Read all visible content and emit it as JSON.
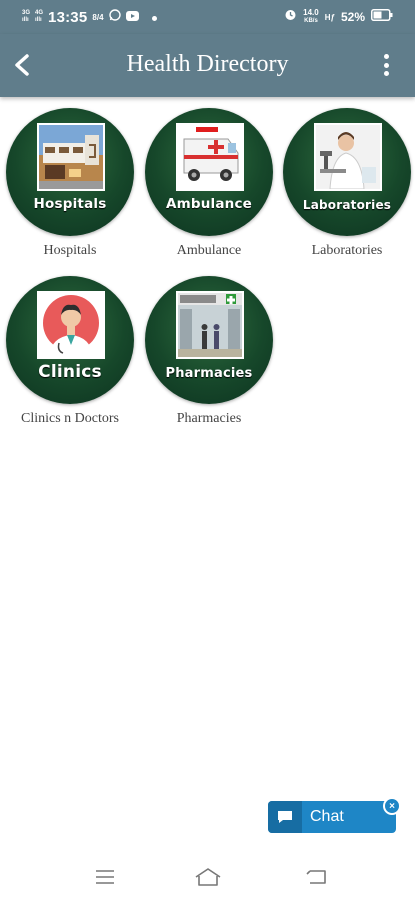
{
  "status_bar": {
    "net1_top": "3G",
    "net1_bottom": "ıllı",
    "net2_top": "4G",
    "net2_bottom": "ıllı",
    "time": "13:35",
    "data_rate_small": "8/4",
    "speed_value": "14.0",
    "speed_unit": "KB/s",
    "volte": "Hƒ",
    "battery_percent": "52%"
  },
  "app_bar": {
    "title": "Health Directory"
  },
  "categories": [
    {
      "circle_label": "Hospitals",
      "caption": "Hospitals"
    },
    {
      "circle_label": "Ambulance",
      "caption": "Ambulance"
    },
    {
      "circle_label": "Laboratories",
      "caption": "Laboratories"
    },
    {
      "circle_label": "Clinics",
      "caption": "Clinics n Doctors"
    },
    {
      "circle_label": "Pharmacies",
      "caption": "Pharmacies"
    }
  ],
  "chat_widget": {
    "label": "Chat",
    "close_symbol": "×"
  },
  "colors": {
    "app_bar": "#607d8b",
    "circle_green": "#16472a",
    "chat_blue": "#1e86c6"
  },
  "icons": [
    "back-arrow-icon",
    "overflow-menu-icon",
    "chat-bubble-icon",
    "close-icon",
    "menu-lines-icon",
    "home-icon",
    "back-icon",
    "alarm-icon",
    "whatsapp-icon",
    "youtube-icon",
    "battery-icon"
  ]
}
